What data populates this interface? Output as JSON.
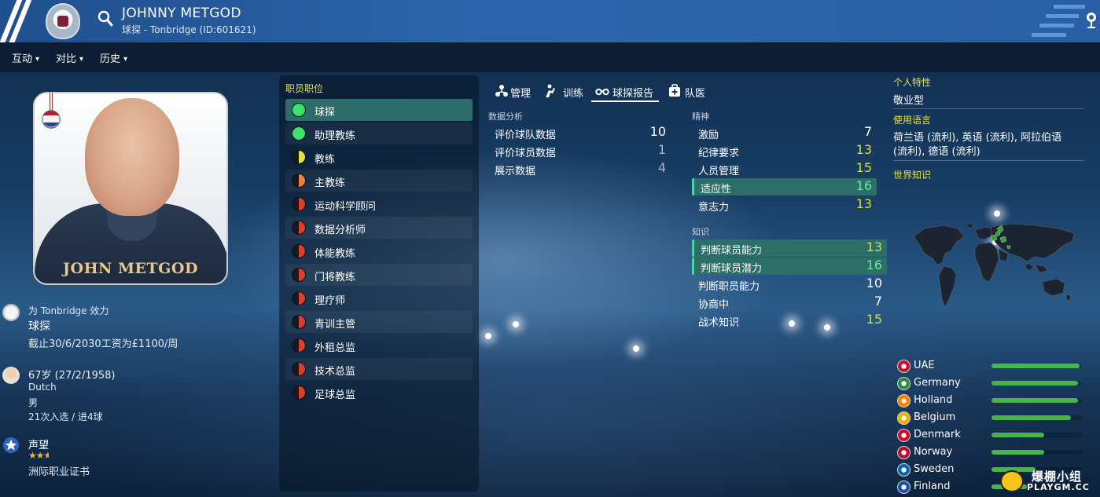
{
  "header": {
    "name": "JOHNNY METGOD",
    "subtitle": "球探 - Tonbridge (ID:601621)"
  },
  "menu": [
    {
      "label": "互动"
    },
    {
      "label": "对比"
    },
    {
      "label": "历史"
    }
  ],
  "photo": {
    "caption": "JOHN METGOD"
  },
  "profile": {
    "club_line": "为 Tonbridge 效力",
    "role": "球探",
    "contract": "截止30/6/2030工资为£1100/周",
    "age": "67岁 (27/2/1958)",
    "nationality": "Dutch",
    "gender": "男",
    "caps": "21次入选 / 进4球",
    "reputation_label": "声望",
    "reputation_stars": 2.5,
    "license": "洲际职业证书"
  },
  "roles": {
    "title": "职员职位",
    "items": [
      {
        "label": "球探",
        "color": "#3be36a",
        "active": true
      },
      {
        "label": "助理教练",
        "color": "#3be36a"
      },
      {
        "label": "教练",
        "color": "half-yellow"
      },
      {
        "label": "主教练",
        "color": "half-orange"
      },
      {
        "label": "运动科学顾问",
        "color": "half-red"
      },
      {
        "label": "数据分析师",
        "color": "half-red"
      },
      {
        "label": "体能教练",
        "color": "half-red"
      },
      {
        "label": "门将教练",
        "color": "half-red"
      },
      {
        "label": "理疗师",
        "color": "half-red"
      },
      {
        "label": "青训主管",
        "color": "half-red"
      },
      {
        "label": "外租总监",
        "color": "half-red"
      },
      {
        "label": "技术总监",
        "color": "half-red"
      },
      {
        "label": "足球总监",
        "color": "half-red"
      }
    ]
  },
  "tabs": [
    {
      "label": "管理",
      "icon": "manage-icon"
    },
    {
      "label": "训练",
      "icon": "training-icon"
    },
    {
      "label": "球探报告",
      "icon": "binoculars-icon",
      "active": true
    },
    {
      "label": "队医",
      "icon": "medical-icon"
    }
  ],
  "data_analysis": {
    "title": "数据分析",
    "rows": [
      {
        "name": "评价球队数据",
        "value": "10"
      },
      {
        "name": "评价球员数据",
        "value": "1"
      },
      {
        "name": "展示数据",
        "value": "4"
      }
    ]
  },
  "mental": {
    "title": "精神",
    "rows": [
      {
        "name": "激励",
        "value": "7"
      },
      {
        "name": "纪律要求",
        "value": "13"
      },
      {
        "name": "人员管理",
        "value": "15"
      },
      {
        "name": "适应性",
        "value": "16"
      },
      {
        "name": "意志力",
        "value": "13"
      }
    ]
  },
  "knowledge": {
    "title": "知识",
    "rows": [
      {
        "name": "判断球员能力",
        "value": "13"
      },
      {
        "name": "判断球员潜力",
        "value": "16"
      },
      {
        "name": "判断职员能力",
        "value": "10"
      },
      {
        "name": "协商中",
        "value": "7"
      },
      {
        "name": "战术知识",
        "value": "15"
      }
    ]
  },
  "right_panel": {
    "traits_label": "个人特性",
    "traits_value": "敬业型",
    "languages_label": "使用语言",
    "languages_line1": "荷兰语 (流利), 英语 (流利), 阿拉伯语",
    "languages_line2": "(流利), 德语 (流利)",
    "world_label": "世界知识"
  },
  "nations": [
    {
      "name": "UAE",
      "level": 1.0,
      "flag": "#c8102e"
    },
    {
      "name": "Germany",
      "level": 0.98,
      "flag": "#2d8a3e"
    },
    {
      "name": "Holland",
      "level": 0.98,
      "flag": "#ff7f00"
    },
    {
      "name": "Belgium",
      "level": 0.9,
      "flag": "#e8b400"
    },
    {
      "name": "Denmark",
      "level": 0.6,
      "flag": "#c8102e"
    },
    {
      "name": "Norway",
      "level": 0.6,
      "flag": "#ba0c2f"
    },
    {
      "name": "Sweden",
      "level": 0.5,
      "flag": "#006aa7"
    },
    {
      "name": "Finland",
      "level": 0.4,
      "flag": "#1f4fa0"
    }
  ],
  "watermark": {
    "cn": "爆棚小组",
    "en": "PLAYGM.CC"
  },
  "colors": {
    "header": "#2d66ad",
    "accent_yellow": "#e5e04a",
    "highlight_row": "#2c6e68",
    "bar_green": "#47b54c"
  }
}
